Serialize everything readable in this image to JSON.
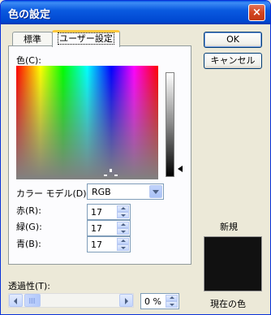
{
  "window": {
    "title": "色の設定",
    "close_symbol": "×"
  },
  "tabs": [
    {
      "label": "標準",
      "active": false
    },
    {
      "label": "ユーザー設定",
      "active": true
    }
  ],
  "color_label": "色(C):",
  "color_model": {
    "label": "カラー モデル(D):",
    "value": "RGB"
  },
  "channels": [
    {
      "label": "赤(R):",
      "value": "17"
    },
    {
      "label": "緑(G):",
      "value": "17"
    },
    {
      "label": "青(B):",
      "value": "17"
    }
  ],
  "transparency": {
    "label": "透過性(T):",
    "value": "0 %"
  },
  "buttons": {
    "ok": "OK",
    "cancel": "キャンセル"
  },
  "preview": {
    "new_label": "新規",
    "current_label": "現在の色",
    "color": "#111111"
  },
  "colors": {
    "titlebar": "#0a5ae0",
    "dialog_bg": "#ece9d8",
    "active_tab_accent": "#ffc83c"
  }
}
